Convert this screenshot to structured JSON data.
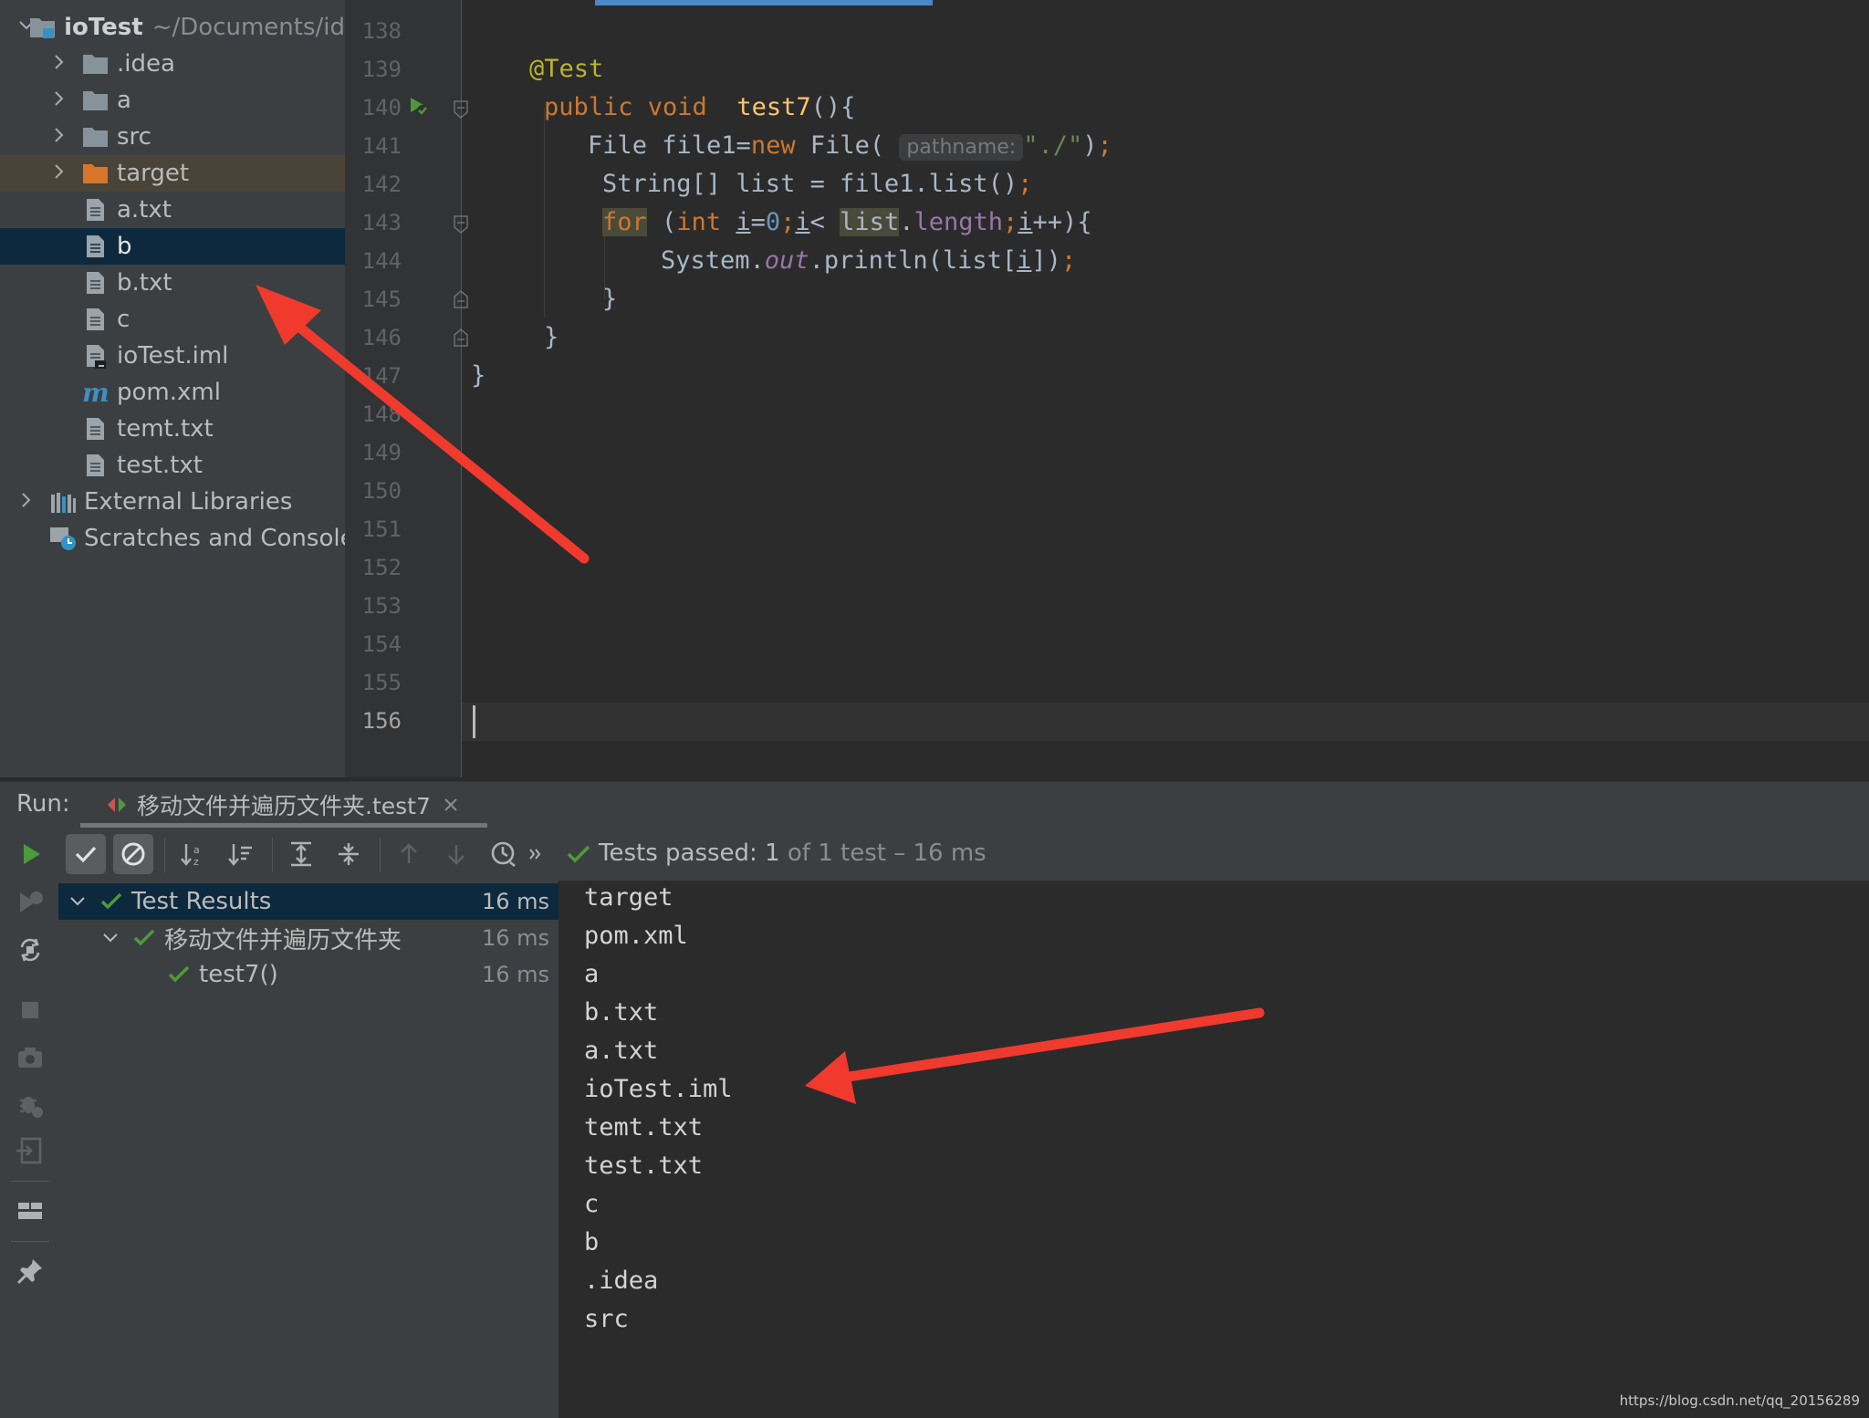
{
  "project": {
    "root_name": "ioTest",
    "root_path": "~/Documents/id",
    "items": [
      {
        "label": ".idea",
        "kind": "folder"
      },
      {
        "label": "a",
        "kind": "folder"
      },
      {
        "label": "src",
        "kind": "folder"
      },
      {
        "label": "target",
        "kind": "folder-excluded"
      },
      {
        "label": "a.txt",
        "kind": "file"
      },
      {
        "label": "b",
        "kind": "file"
      },
      {
        "label": "b.txt",
        "kind": "file"
      },
      {
        "label": "c",
        "kind": "file"
      },
      {
        "label": "ioTest.iml",
        "kind": "iml"
      },
      {
        "label": "pom.xml",
        "kind": "maven"
      },
      {
        "label": "temt.txt",
        "kind": "file"
      },
      {
        "label": "test.txt",
        "kind": "file"
      }
    ],
    "external_libraries": "External Libraries",
    "scratches": "Scratches and Consoles"
  },
  "editor": {
    "line_numbers": [
      "138",
      "139",
      "140",
      "141",
      "142",
      "143",
      "144",
      "145",
      "146",
      "147",
      "148",
      "149",
      "150",
      "151",
      "152",
      "153",
      "154",
      "155",
      "156"
    ],
    "current_line": "156",
    "inlay_hint": "pathname:"
  },
  "run": {
    "label": "Run:",
    "tab_title": "移动文件并遍历文件夹.test7",
    "status_passed": "Tests passed:",
    "status_count": "1",
    "status_rest": "of 1 test – 16 ms",
    "results": [
      {
        "label": "Test Results",
        "time": "16 ms"
      },
      {
        "label": "移动文件并遍历文件夹",
        "time": "16 ms"
      },
      {
        "label": "test7()",
        "time": "16 ms"
      }
    ],
    "console_output": [
      "target",
      "pom.xml",
      "a",
      "b.txt",
      "a.txt",
      "ioTest.iml",
      "temt.txt",
      "test.txt",
      "c",
      "b",
      ".idea",
      "src"
    ]
  },
  "watermark": "https://blog.csdn.net/qq_20156289",
  "colors": {
    "selection": "#0d293e",
    "annotation_arrow": "#f03a2e",
    "pass_green": "#4e9a3a"
  }
}
